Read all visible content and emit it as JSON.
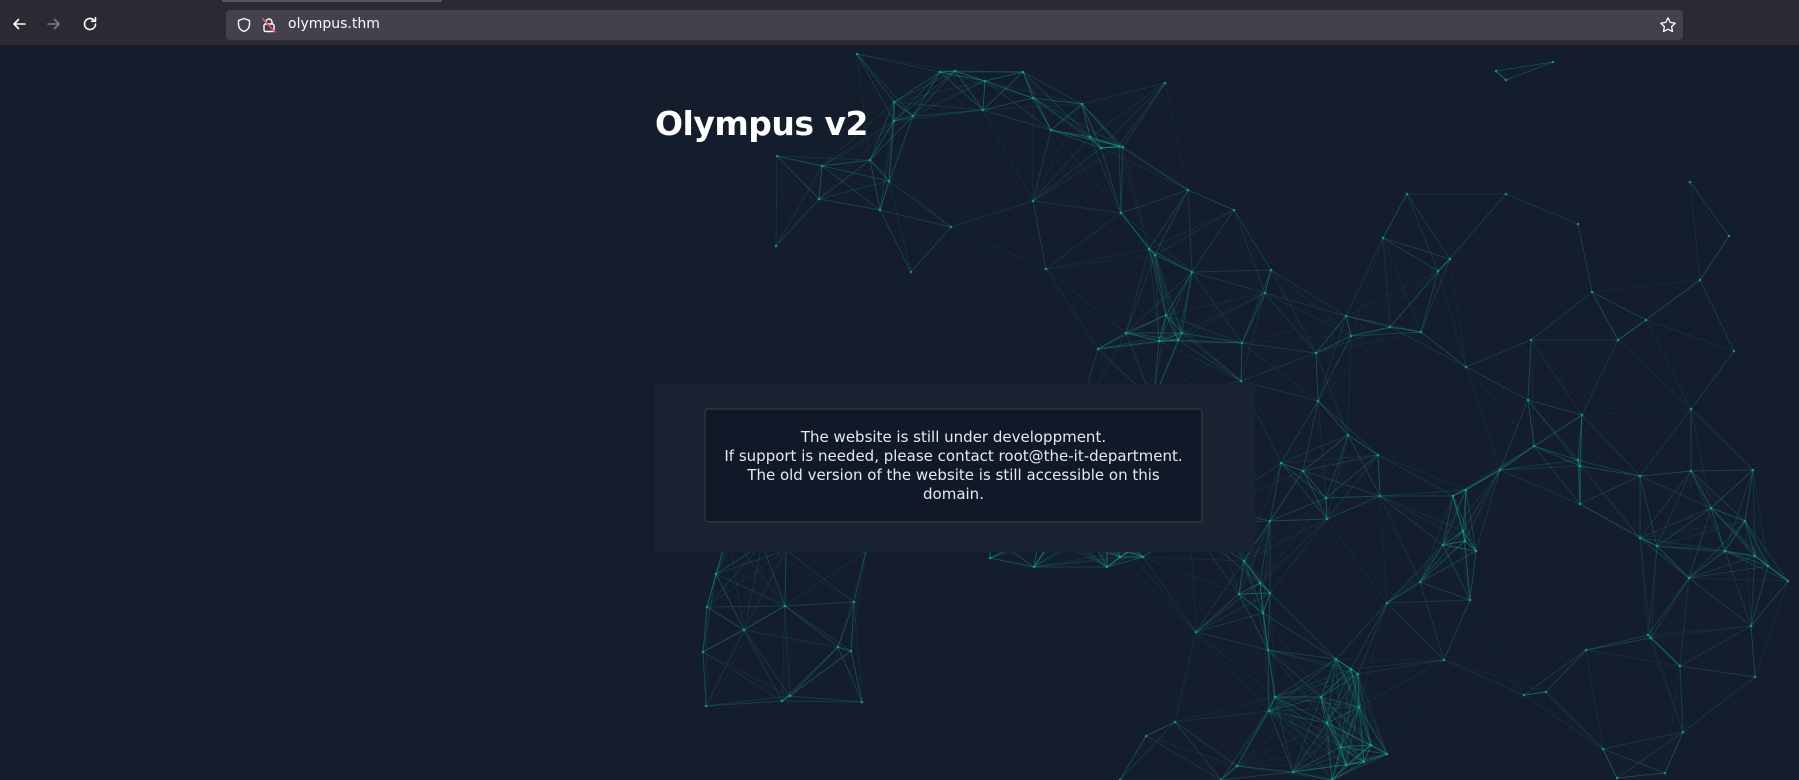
{
  "browser": {
    "url": "olympus.thm",
    "back_icon": "arrow-left-icon",
    "forward_icon": "arrow-right-icon",
    "reload_icon": "reload-icon",
    "shield_icon": "shield-icon",
    "lock_icon": "insecure-lock-icon",
    "bookmark_icon": "star-icon"
  },
  "page": {
    "title": "Olympus v2",
    "notice": {
      "line1": "The website is still under developpment.",
      "line2": "If support is needed, please contact root@the-it-department.",
      "line3": "The old version of the website is still accessible on this",
      "line4": "domain."
    }
  },
  "colors": {
    "background": "#141d2b",
    "network_lines": "#1aa39a",
    "panel": "#1a2332",
    "notice_box": "#111827",
    "text": "#ffffff"
  }
}
